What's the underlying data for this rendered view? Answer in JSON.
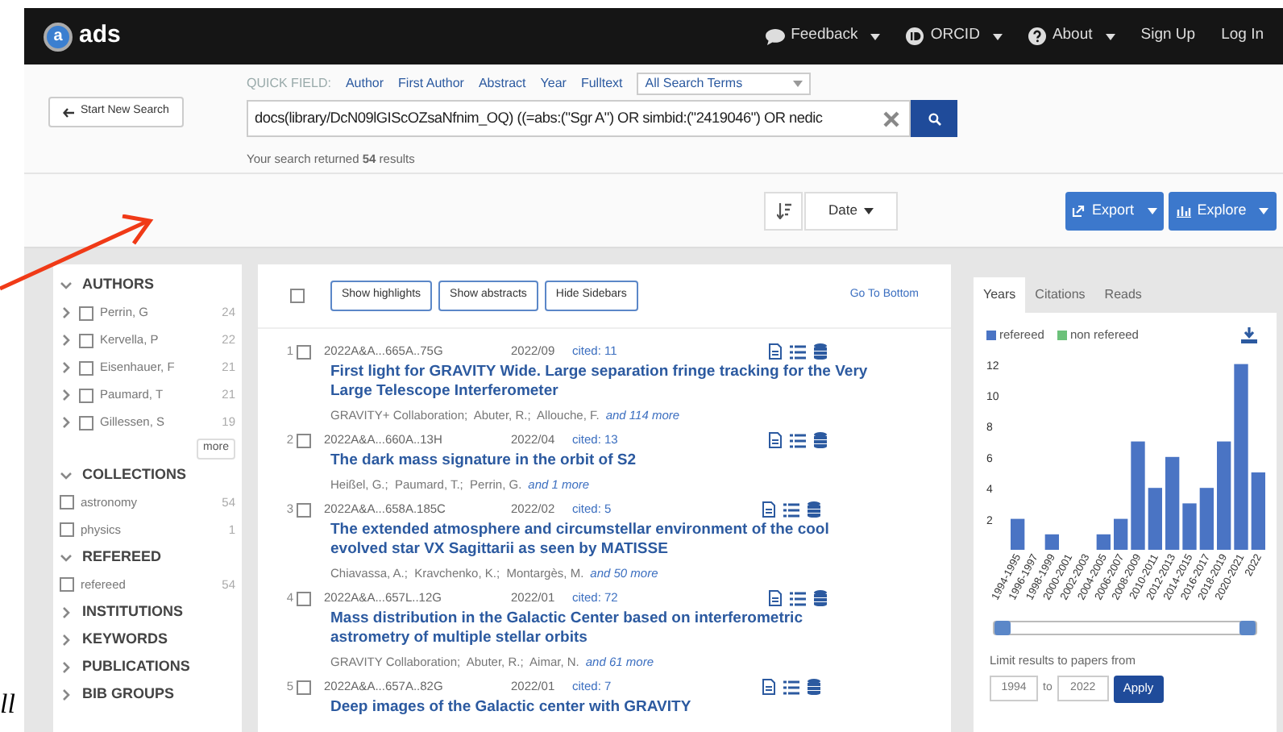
{
  "annotation": {
    "fragment_text": "ll"
  },
  "navbar": {
    "logo_letter": "a",
    "brand": "ads",
    "menu": [
      {
        "label": "Feedback",
        "dropdown": true,
        "kind": "speech"
      },
      {
        "label": "ORCID",
        "dropdown": true,
        "kind": "orcid"
      },
      {
        "label": "About",
        "dropdown": true,
        "kind": "question"
      },
      {
        "label": "Sign Up",
        "dropdown": false,
        "kind": "plain"
      },
      {
        "label": "Log In",
        "dropdown": false,
        "kind": "plain"
      }
    ]
  },
  "search": {
    "start_new": "Start New Search",
    "quick_field_label": "QUICK FIELD:",
    "quick_fields": [
      "Author",
      "First Author",
      "Abstract",
      "Year",
      "Fulltext"
    ],
    "term_select": "All Search Terms",
    "query": "docs(library/DcN09lGIScOZsaNfnim_OQ) ((=abs:(\"Sgr A\") OR simbid:(\"2419046\") OR nedic",
    "summary": "Your search returned **54** results"
  },
  "toolbar": {
    "sort_by": "Date",
    "export": "Export",
    "explore": "Explore"
  },
  "facets": [
    {
      "title": "AUTHORS",
      "expanded": true,
      "more": "more",
      "items": [
        {
          "label": "Perrin, G",
          "count": "24",
          "expandable": true,
          "checked": false
        },
        {
          "label": "Kervella, P",
          "count": "22",
          "expandable": true,
          "checked": false
        },
        {
          "label": "Eisenhauer, F",
          "count": "21",
          "expandable": true,
          "checked": false
        },
        {
          "label": "Paumard, T",
          "count": "21",
          "expandable": true,
          "checked": false
        },
        {
          "label": "Gillessen, S",
          "count": "19",
          "expandable": true,
          "checked": false
        }
      ]
    },
    {
      "title": "COLLECTIONS",
      "expanded": true,
      "items": [
        {
          "label": "astronomy",
          "count": "54",
          "expandable": false,
          "checked": false
        },
        {
          "label": "physics",
          "count": "1",
          "expandable": false,
          "checked": false
        }
      ]
    },
    {
      "title": "REFEREED",
      "expanded": true,
      "items": [
        {
          "label": "refereed",
          "count": "54",
          "expandable": false,
          "checked": false
        }
      ]
    },
    {
      "title": "INSTITUTIONS",
      "expanded": false
    },
    {
      "title": "KEYWORDS",
      "expanded": false
    },
    {
      "title": "PUBLICATIONS",
      "expanded": false
    },
    {
      "title": "BIB GROUPS",
      "expanded": false
    }
  ],
  "results_toolbar": {
    "select_all_checked": false,
    "buttons": [
      "Show highlights",
      "Show abstracts",
      "Hide Sidebars"
    ],
    "go_to_bottom": "Go To Bottom"
  },
  "results": [
    {
      "index": "1",
      "checked": false,
      "bibcode": "2022A&A...665A..75G",
      "date": "2022/09",
      "cited": "cited: 11",
      "title": "First light for GRAVITY Wide. Large separation fringe tracking for the Very Large Telescope Interferometer",
      "authors": "GRAVITY+ Collaboration;  Abuter, R.;  Allouche, F.",
      "more": "and 114 more"
    },
    {
      "index": "2",
      "checked": false,
      "bibcode": "2022A&A...660A..13H",
      "date": "2022/04",
      "cited": "cited: 13",
      "title": "The dark mass signature in the orbit of S2",
      "authors": "Heißel, G.;  Paumard, T.;  Perrin, G.",
      "more": "and 1 more"
    },
    {
      "index": "3",
      "checked": false,
      "bibcode": "2022A&A...658A.185C",
      "date": "2022/02",
      "cited": "cited: 5",
      "title": "The extended atmosphere and circumstellar environment of the cool evolved star VX Sagittarii as seen by MATISSE",
      "authors": "Chiavassa, A.;  Kravchenko, K.;  Montargès, M.",
      "more": "and 50 more"
    },
    {
      "index": "4",
      "checked": false,
      "bibcode": "2022A&A...657L..12G",
      "date": "2022/01",
      "cited": "cited: 72",
      "title": "Mass distribution in the Galactic Center based on interferometric astrometry of multiple stellar orbits",
      "authors": "GRAVITY Collaboration;  Abuter, R.;  Aimar, N.",
      "more": "and 61 more"
    },
    {
      "index": "5",
      "checked": false,
      "bibcode": "2022A&A...657A..82G",
      "date": "2022/01",
      "cited": "cited: 7",
      "title": "Deep images of the Galactic center with GRAVITY"
    }
  ],
  "graph_tabs": [
    {
      "label": "Years",
      "selected": true
    },
    {
      "label": "Citations",
      "selected": false
    },
    {
      "label": "Reads",
      "selected": false
    }
  ],
  "chart_data": {
    "type": "bar",
    "categories": [
      "1994-1995",
      "1996-1997",
      "1998-1999",
      "2000-2001",
      "2002-2003",
      "2004-2005",
      "2006-2007",
      "2008-2009",
      "2010-2011",
      "2012-2013",
      "2014-2015",
      "2016-2017",
      "2018-2019",
      "2020-2021",
      "2022"
    ],
    "yticks": [
      2,
      4,
      6,
      8,
      10,
      12
    ],
    "ylim": [
      0,
      12.5
    ],
    "series": [
      {
        "name": "refereed",
        "color": "#4a74c4",
        "values": [
          2,
          0,
          1,
          0,
          0,
          1,
          2,
          7,
          4,
          6,
          3,
          4,
          7,
          12,
          5
        ]
      },
      {
        "name": "non refereed",
        "color": "#6cc17a",
        "values": [
          0,
          0,
          0,
          0,
          0,
          0,
          0,
          0,
          0,
          0,
          0,
          0,
          0,
          0,
          0
        ]
      }
    ]
  },
  "range_slider": {
    "thumbs": [
      {
        "level": 0
      },
      {
        "level": 1
      }
    ]
  },
  "limit": {
    "label": "Limit results to papers from",
    "from": "1994",
    "to_label": "to",
    "to": "2022",
    "apply": "Apply"
  }
}
